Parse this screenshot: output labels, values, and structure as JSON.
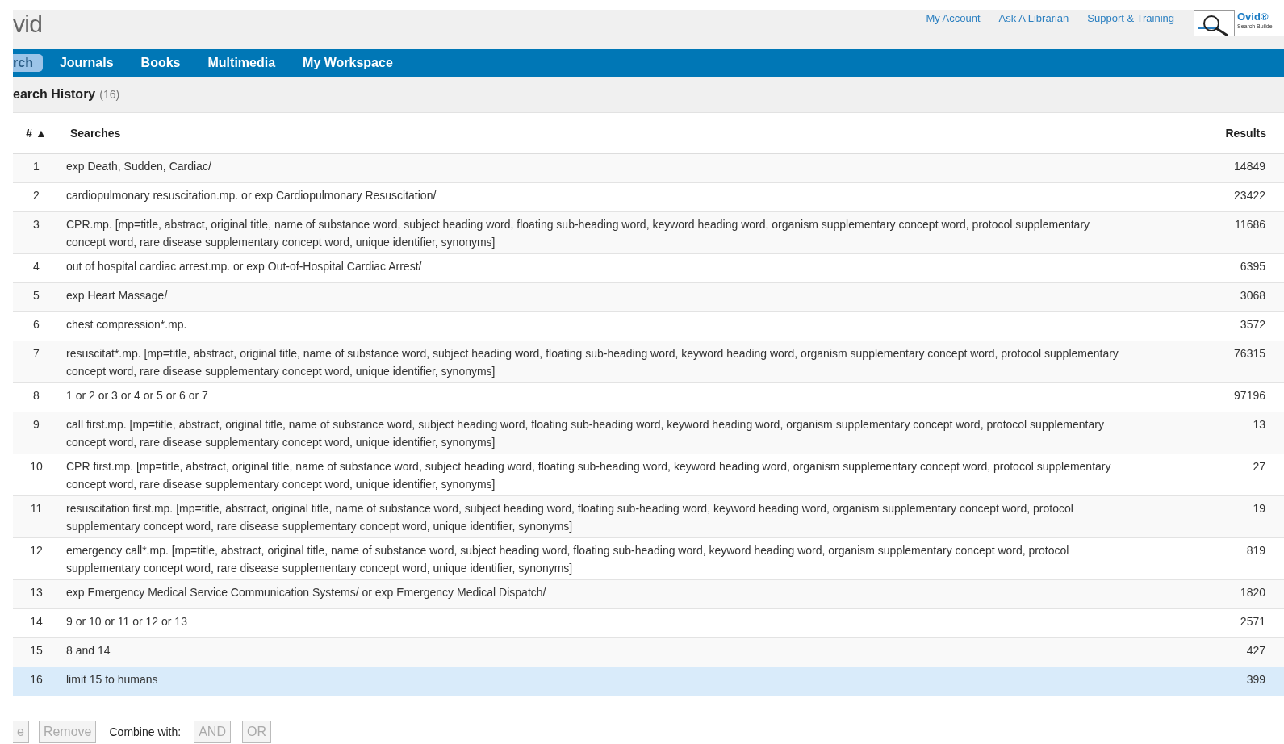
{
  "logo": "vid",
  "top_links": [
    "My Account",
    "Ask A Librarian",
    "Support & Training"
  ],
  "search_builder": {
    "brand": "Ovid®",
    "caption": "Search Builde"
  },
  "nav_tabs": [
    {
      "label": "rch",
      "selected": true
    },
    {
      "label": "Journals",
      "selected": false
    },
    {
      "label": "Books",
      "selected": false
    },
    {
      "label": "Multimedia",
      "selected": false
    },
    {
      "label": "My Workspace",
      "selected": false
    }
  ],
  "section": {
    "title": "earch History",
    "count": "(16)"
  },
  "table": {
    "columns": [
      "# ▲",
      "Searches",
      "Results"
    ],
    "rows": [
      {
        "number": "1",
        "search": "exp Death, Sudden, Cardiac/",
        "results": "14849",
        "selected": false
      },
      {
        "number": "2",
        "search": "cardiopulmonary resuscitation.mp. or exp Cardiopulmonary Resuscitation/",
        "results": "23422",
        "selected": false
      },
      {
        "number": "3",
        "search": "CPR.mp. [mp=title, abstract, original title, name of substance word, subject heading word, floating sub-heading word, keyword heading word, organism supplementary concept word, protocol supplementary concept word, rare disease supplementary concept word, unique identifier, synonyms]",
        "results": "11686",
        "selected": false
      },
      {
        "number": "4",
        "search": "out of hospital cardiac arrest.mp. or exp Out-of-Hospital Cardiac Arrest/",
        "results": "6395",
        "selected": false
      },
      {
        "number": "5",
        "search": "exp Heart Massage/",
        "results": "3068",
        "selected": false
      },
      {
        "number": "6",
        "search": "chest compression*.mp.",
        "results": "3572",
        "selected": false
      },
      {
        "number": "7",
        "search": "resuscitat*.mp. [mp=title, abstract, original title, name of substance word, subject heading word, floating sub-heading word, keyword heading word, organism supplementary concept word, protocol supplementary concept word, rare disease supplementary concept word, unique identifier, synonyms]",
        "results": "76315",
        "selected": false
      },
      {
        "number": "8",
        "search": "1 or 2 or 3 or 4 or 5 or 6 or 7",
        "results": "97196",
        "selected": false
      },
      {
        "number": "9",
        "search": "call first.mp. [mp=title, abstract, original title, name of substance word, subject heading word, floating sub-heading word, keyword heading word, organism supplementary concept word, protocol supplementary concept word, rare disease supplementary concept word, unique identifier, synonyms]",
        "results": "13",
        "selected": false
      },
      {
        "number": "10",
        "search": "CPR first.mp. [mp=title, abstract, original title, name of substance word, subject heading word, floating sub-heading word, keyword heading word, organism supplementary concept word, protocol supplementary concept word, rare disease supplementary concept word, unique identifier, synonyms]",
        "results": "27",
        "selected": false
      },
      {
        "number": "11",
        "search": "resuscitation first.mp. [mp=title, abstract, original title, name of substance word, subject heading word, floating sub-heading word, keyword heading word, organism supplementary concept word, protocol supplementary concept word, rare disease supplementary concept word, unique identifier, synonyms]",
        "results": "19",
        "selected": false
      },
      {
        "number": "12",
        "search": "emergency call*.mp. [mp=title, abstract, original title, name of substance word, subject heading word, floating sub-heading word, keyword heading word, organism supplementary concept word, protocol supplementary concept word, rare disease supplementary concept word, unique identifier, synonyms]",
        "results": "819",
        "selected": false
      },
      {
        "number": "13",
        "search": "exp Emergency Medical Service Communication Systems/ or exp Emergency Medical Dispatch/",
        "results": "1820",
        "selected": false
      },
      {
        "number": "14",
        "search": "9 or 10 or 11 or 12 or 13",
        "results": "2571",
        "selected": false
      },
      {
        "number": "15",
        "search": "8 and 14",
        "results": "427",
        "selected": false
      },
      {
        "number": "16",
        "search": "limit 15 to humans",
        "results": "399",
        "selected": true
      }
    ]
  },
  "actions": [
    {
      "kind": "button",
      "label": "e",
      "disabled": true
    },
    {
      "kind": "button",
      "label": "Remove",
      "disabled": true
    },
    {
      "kind": "label",
      "label": "Combine with:"
    },
    {
      "kind": "button",
      "label": "AND",
      "disabled": true
    },
    {
      "kind": "button",
      "label": "OR",
      "disabled": true
    }
  ]
}
